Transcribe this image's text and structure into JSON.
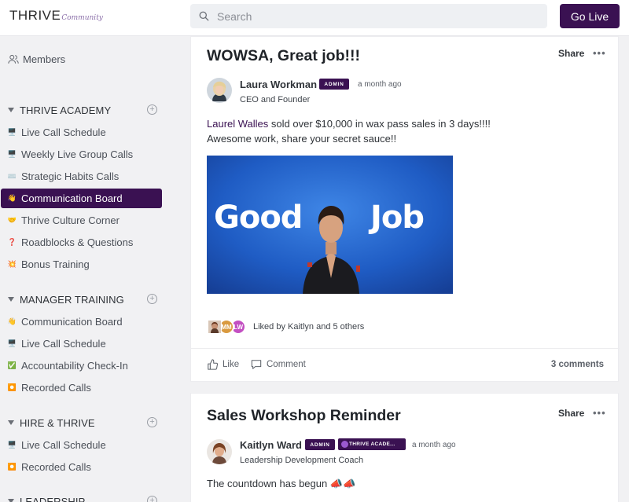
{
  "header": {
    "logo_main": "THRIVE",
    "logo_script": "Community",
    "search_placeholder": "Search",
    "go_live_label": "Go Live"
  },
  "sidebar": {
    "members_label": "Members",
    "sections": [
      {
        "title": "THRIVE ACADEMY",
        "items": [
          {
            "emoji": "🖥️",
            "label": "Live Call Schedule"
          },
          {
            "emoji": "🖥️",
            "label": "Weekly Live Group Calls"
          },
          {
            "emoji": "⌨️",
            "label": "Strategic Habits Calls"
          },
          {
            "emoji": "👋",
            "label": "Communication Board",
            "active": true
          },
          {
            "emoji": "🤝",
            "label": "Thrive Culture Corner"
          },
          {
            "emoji": "❓",
            "label": "Roadblocks & Questions"
          },
          {
            "emoji": "💥",
            "label": "Bonus Training"
          }
        ]
      },
      {
        "title": "MANAGER TRAINING",
        "items": [
          {
            "emoji": "👋",
            "label": "Communication Board"
          },
          {
            "emoji": "🖥️",
            "label": "Live Call Schedule"
          },
          {
            "emoji": "✅",
            "label": "Accountability Check-In"
          },
          {
            "emoji": "⏺️",
            "label": "Recorded Calls"
          }
        ]
      },
      {
        "title": "HIRE & THRIVE",
        "items": [
          {
            "emoji": "🖥️",
            "label": "Live Call Schedule"
          },
          {
            "emoji": "⏺️",
            "label": "Recorded Calls"
          }
        ]
      },
      {
        "title": "LEADERSHIP",
        "items": []
      }
    ]
  },
  "posts": [
    {
      "title": "WOWSA, Great job!!!",
      "share_label": "Share",
      "more_label": "•••",
      "author": "Laura Workman",
      "badge": "ADMIN",
      "time": "a month ago",
      "role": "CEO and Founder",
      "mention": "Laurel Walles",
      "body_line1_rest": " sold over $10,000 in wax pass sales in 3 days!!!!",
      "body_line2": "Awesome work, share your secret sauce!!",
      "gif_word_left": "Good",
      "gif_word_right": "Job",
      "liker_initials": [
        "MM",
        "LW"
      ],
      "liked_text": "Liked by Kaitlyn and 5 others",
      "like_label": "Like",
      "comment_label": "Comment",
      "comments_count": "3 comments"
    },
    {
      "title": "Sales Workshop Reminder",
      "share_label": "Share",
      "more_label": "•••",
      "author": "Kaitlyn Ward",
      "badge": "ADMIN",
      "badge2": "THRIVE ACADE...",
      "time": "a month ago",
      "role": "Leadership Development Coach",
      "body_line1": "The countdown has begun 📣📣"
    }
  ],
  "colors": {
    "brand": "#3a1152",
    "sidebar_bg": "#f1f1f3"
  }
}
